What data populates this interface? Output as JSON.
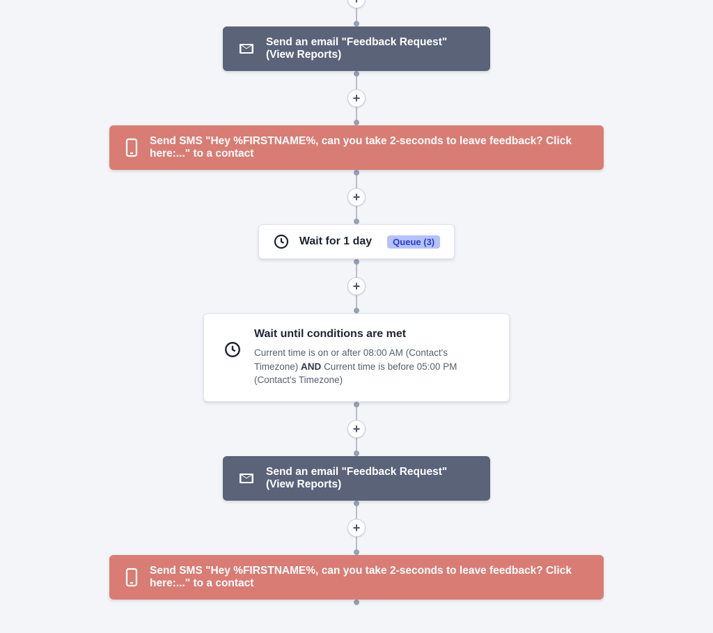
{
  "flow": {
    "email_node_1": {
      "label_prefix": "Send an email \"Feedback Request\" ",
      "label_reports": "(View Reports)"
    },
    "sms_node_1": {
      "label": "Send SMS \"Hey %FIRSTNAME%, can you take 2-seconds to leave feedback? Click here:...\" to a contact"
    },
    "wait_day": {
      "title": "Wait for 1 day",
      "queue_label": "Queue (3)"
    },
    "wait_conditions": {
      "title": "Wait until conditions are met",
      "cond1": "Current time is on or after 08:00 AM (Contact's Timezone)",
      "and": "AND",
      "cond2": "Current time is before 05:00 PM (Contact's Timezone)"
    },
    "email_node_2": {
      "label_prefix": "Send an email \"Feedback Request\" ",
      "label_reports": "(View Reports)"
    },
    "sms_node_2": {
      "label": "Send SMS \"Hey %FIRSTNAME%, can you take 2-seconds to leave feedback? Click here:...\" to a contact"
    },
    "add_button_glyph": "+"
  }
}
